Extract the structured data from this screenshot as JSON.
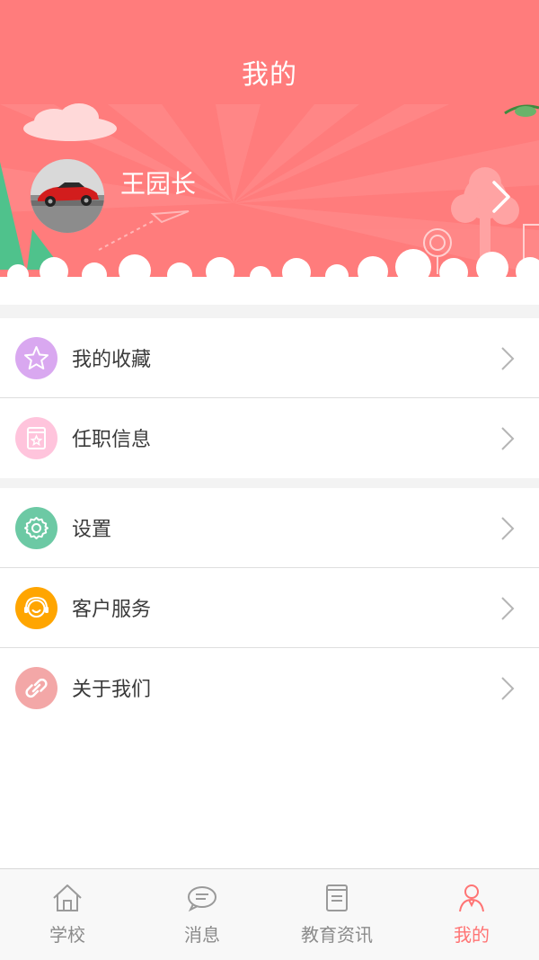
{
  "header": {
    "title": "我的",
    "background_color": "#ff7c7c"
  },
  "profile": {
    "name": "王园长",
    "avatar_icon": "red-sports-car-photo"
  },
  "menu_groups": [
    {
      "items": [
        {
          "label": "我的收藏",
          "icon": "star-icon",
          "icon_color": "#d9a8f0"
        },
        {
          "label": "任职信息",
          "icon": "id-card-icon",
          "icon_color": "#ffc4dc"
        }
      ]
    },
    {
      "items": [
        {
          "label": "设置",
          "icon": "gear-icon",
          "icon_color": "#6cc9a4"
        },
        {
          "label": "客户服务",
          "icon": "customer-service-icon",
          "icon_color": "#ffa500"
        },
        {
          "label": "关于我们",
          "icon": "link-icon",
          "icon_color": "#f3a7a7"
        }
      ]
    }
  ],
  "tabbar": {
    "tabs": [
      {
        "label": "学校",
        "icon": "home-icon",
        "active": false
      },
      {
        "label": "消息",
        "icon": "chat-bubble-icon",
        "active": false
      },
      {
        "label": "教育资讯",
        "icon": "document-icon",
        "active": false
      },
      {
        "label": "我的",
        "icon": "person-icon",
        "active": true
      }
    ],
    "active_color": "#ff7474",
    "inactive_color": "#8b8b8b"
  }
}
